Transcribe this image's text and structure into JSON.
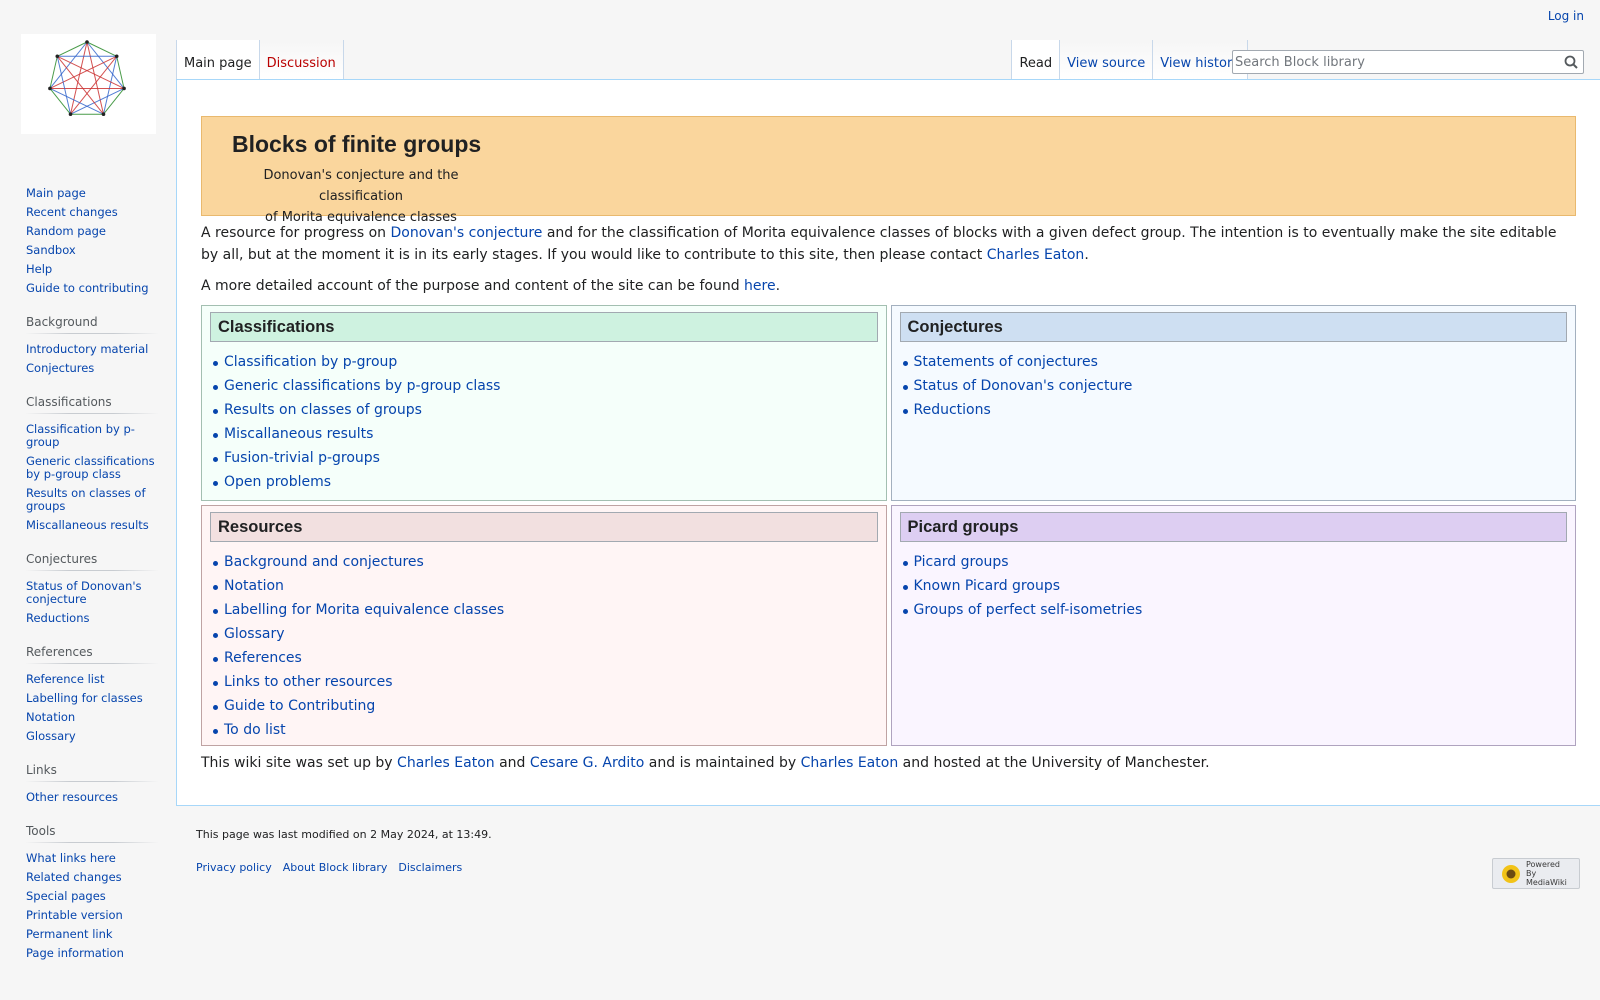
{
  "personal": {
    "login": "Log in"
  },
  "tabs": {
    "main_page": "Main page",
    "discussion": "Discussion",
    "read": "Read",
    "view_source": "View source",
    "view_history": "View history"
  },
  "search": {
    "placeholder": "Search Block library"
  },
  "sidebar": {
    "navigation": [
      "Main page",
      "Recent changes",
      "Random page",
      "Sandbox",
      "Help",
      "Guide to contributing"
    ],
    "sections": [
      {
        "title": "Background",
        "items": [
          "Introductory material",
          "Conjectures"
        ]
      },
      {
        "title": "Classifications",
        "items": [
          "Classification by p-group",
          "Generic classifications by p-group class",
          "Results on classes of groups",
          "Miscallaneous results"
        ]
      },
      {
        "title": "Conjectures",
        "items": [
          "Status of Donovan's conjecture",
          "Reductions"
        ]
      },
      {
        "title": "References",
        "items": [
          "Reference list",
          "Labelling for classes",
          "Notation",
          "Glossary"
        ]
      },
      {
        "title": "Links",
        "items": [
          "Other resources"
        ]
      },
      {
        "title": "Tools",
        "items": [
          "What links here",
          "Related changes",
          "Special pages",
          "Printable version",
          "Permanent link",
          "Page information"
        ]
      }
    ]
  },
  "banner": {
    "title": "Blocks of finite groups",
    "subtitle_line1": "Donovan's conjecture and the classification",
    "subtitle_line2": "of Morita equivalence classes"
  },
  "intro": {
    "t1": "A resource for progress on ",
    "l1": "Donovan's conjecture",
    "t2": " and for the classification of Morita equivalence classes of blocks with a given defect group. The intention is to eventually make the site editable by all, but at the moment it is in its early stages. If you would like to contribute to this site, then please contact ",
    "l2": "Charles Eaton",
    "t3": "."
  },
  "detail": {
    "t1": "A more detailed account of the purpose and content of the site can be found ",
    "l1": "here",
    "t2": "."
  },
  "boxes": {
    "classifications": {
      "title": "Classifications",
      "items": [
        "Classification by p-group",
        "Generic classifications by p-group class",
        "Results on classes of groups",
        "Miscallaneous results",
        "Fusion-trivial p-groups",
        "Open problems"
      ]
    },
    "conjectures": {
      "title": "Conjectures",
      "items": [
        "Statements of conjectures",
        "Status of Donovan's conjecture",
        "Reductions"
      ]
    },
    "resources": {
      "title": "Resources",
      "items": [
        "Background and conjectures",
        "Notation",
        "Labelling for Morita equivalence classes",
        "Glossary",
        "References",
        "Links to other resources",
        "Guide to Contributing",
        "To do list"
      ]
    },
    "picard": {
      "title": "Picard groups",
      "items": [
        "Picard groups",
        "Known Picard groups",
        "Groups of perfect self-isometries"
      ]
    }
  },
  "setup": {
    "t1": "This wiki site was set up by ",
    "l1": "Charles Eaton",
    "t2": " and ",
    "l2": "Cesare G. Ardito",
    "t3": " and is maintained by ",
    "l3": "Charles Eaton",
    "t4": " and hosted at the University of Manchester."
  },
  "footer": {
    "last_modified": "This page was last modified on 2 May 2024, at 13:49.",
    "privacy": "Privacy policy",
    "about": "About Block library",
    "disclaimers": "Disclaimers",
    "powered": "Powered By MediaWiki"
  },
  "icons": {
    "logo": "heptagon-graph-logo",
    "search": "magnifier-icon"
  }
}
